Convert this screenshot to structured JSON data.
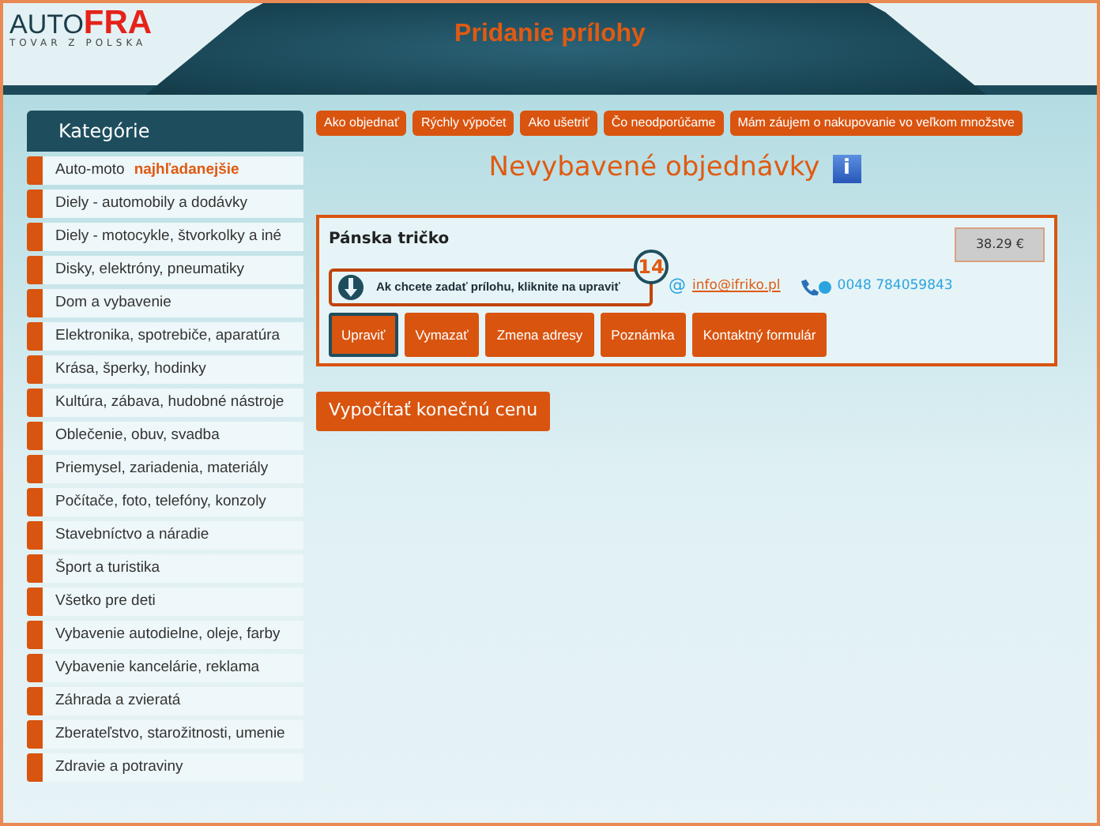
{
  "header": {
    "logo": {
      "part_1": "AUTO",
      "part_2": "FRA",
      "tagline": "TOVAR Z POLSKA"
    },
    "title": "Pridanie prílohy"
  },
  "sidebar": {
    "heading": "Kategórie",
    "items": [
      {
        "label": "Auto-moto",
        "tag": "najhľadanejšie"
      },
      {
        "label": "Diely - automobily a dodávky"
      },
      {
        "label": "Diely - motocykle, štvorkolky a iné"
      },
      {
        "label": "Disky, elektróny, pneumatiky"
      },
      {
        "label": "Dom a vybavenie"
      },
      {
        "label": "Elektronika, spotrebiče, aparatúra"
      },
      {
        "label": "Krása, šperky, hodinky"
      },
      {
        "label": "Kultúra, zábava, hudobné nástroje"
      },
      {
        "label": "Oblečenie, obuv, svadba"
      },
      {
        "label": "Priemysel, zariadenia, materiály"
      },
      {
        "label": "Počítače, foto, telefóny, konzoly"
      },
      {
        "label": "Stavebníctvo a náradie"
      },
      {
        "label": "Šport a turistika"
      },
      {
        "label": "Všetko pre deti"
      },
      {
        "label": "Vybavenie autodielne, oleje, farby"
      },
      {
        "label": "Vybavenie kancelárie, reklama"
      },
      {
        "label": "Záhrada a zvieratá"
      },
      {
        "label": "Zberateľstvo, starožitnosti, umenie"
      },
      {
        "label": "Zdravie a potraviny"
      }
    ]
  },
  "top_links": [
    "Ako objednať",
    "Rýchly výpočet",
    "Ako ušetriť",
    "Čo neodporúčame",
    "Mám záujem o nakupovanie vo veľkom množstve"
  ],
  "page_title": "Nevybavené objednávky",
  "info_icon": "i",
  "order": {
    "product": "Pánska tričko",
    "price": "38.29 €",
    "callout": {
      "step": "14",
      "text": "Ak chcete zadať prílohu, kliknite na upraviť"
    },
    "email_icon": "@",
    "email": "info@ifriko.pl",
    "phone": "0048 784059843",
    "buttons": [
      {
        "label": "Upraviť",
        "selected": true
      },
      {
        "label": "Vymazať",
        "selected": false
      },
      {
        "label": "Zmena adresy",
        "selected": false
      },
      {
        "label": "Poznámka",
        "selected": false
      },
      {
        "label": "Kontaktný formulár",
        "selected": false
      }
    ]
  },
  "total_button": "Vypočítať konečnú cenu"
}
